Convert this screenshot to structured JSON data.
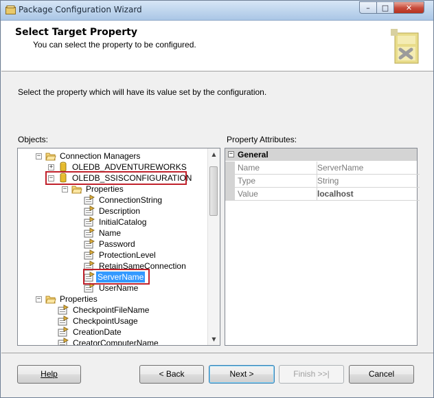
{
  "window": {
    "title": "Package Configuration Wizard",
    "controls": {
      "minimize": "–",
      "maximize": "□",
      "close": "✕"
    }
  },
  "header": {
    "title": "Select Target Property",
    "subtitle": "You can select the property to be configured."
  },
  "instruction": "Select the property which will have its value set by the configuration.",
  "objects_label": "Objects:",
  "attributes_label": "Property Attributes:",
  "tree": {
    "connection_managers": "Connection Managers",
    "cm_items": [
      "OLEDB_ADVENTUREWORKS",
      "OLEDB_SSISCONFIGURATION"
    ],
    "properties_folder": "Properties",
    "cm_properties": [
      "ConnectionString",
      "Description",
      "InitialCatalog",
      "Name",
      "Password",
      "ProtectionLevel",
      "RetainSameConnection",
      "ServerName",
      "UserName"
    ],
    "selected_property": "ServerName",
    "package_properties_folder": "Properties",
    "package_properties": [
      "CheckpointFileName",
      "CheckpointUsage",
      "CreationDate",
      "CreatorComputerName"
    ]
  },
  "property_attributes": {
    "category": "General",
    "rows": [
      {
        "name": "Name",
        "value": "ServerName"
      },
      {
        "name": "Type",
        "value": "String"
      },
      {
        "name": "Value",
        "value": "localhost"
      }
    ]
  },
  "buttons": {
    "help": "Help",
    "back": "< Back",
    "next": "Next >",
    "finish": "Finish >>|",
    "cancel": "Cancel"
  },
  "colors": {
    "selection": "#3399ff",
    "highlight_box": "#c0202a",
    "close_button": "#c7493a"
  }
}
